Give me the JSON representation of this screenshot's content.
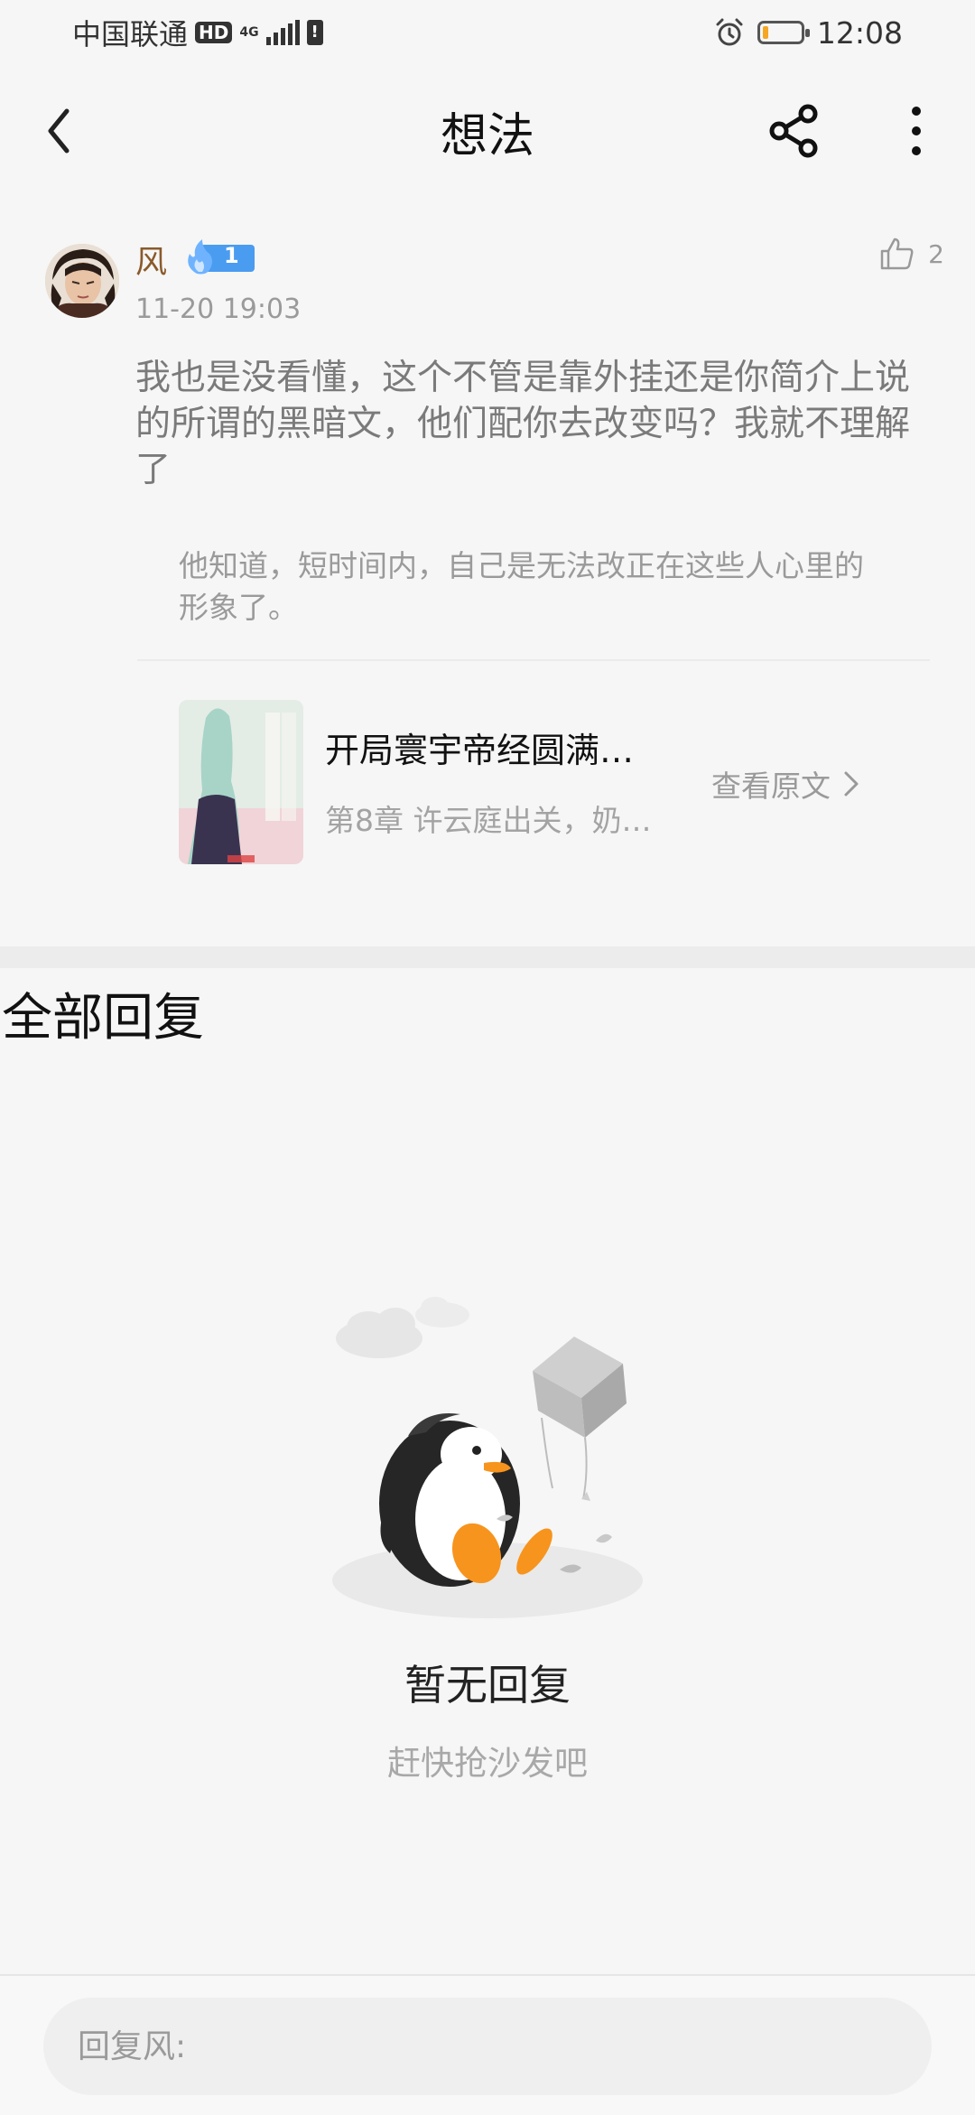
{
  "status_bar": {
    "carrier": "中国联通",
    "hd_badge": "HD",
    "network": "4G",
    "sim_alert": "!",
    "time": "12:08",
    "battery_level_percent": 15,
    "battery_color": "#f5a623"
  },
  "header": {
    "title": "想法",
    "back_icon": "chevron-left-icon",
    "share_icon": "share-icon",
    "more_icon": "more-vertical-icon"
  },
  "post": {
    "author": "风",
    "level": "1",
    "time": "11-20 19:03",
    "like_count": "2",
    "text": "我也是没看懂，这个不管是靠外挂还是你简介上说的所谓的黑暗文，他们配你去改变吗？我就不理解了",
    "quote": "他知道，短时间内，自己是无法改正在这些人心里的形象了。"
  },
  "book": {
    "title": "开局寰宇帝经圆满…",
    "chapter": "第8章 许云庭出关，奶…",
    "view_original": "查看原文"
  },
  "replies": {
    "section_title": "全部回复",
    "empty_title": "暂无回复",
    "empty_subtitle": "赶快抢沙发吧"
  },
  "reply_bar": {
    "placeholder": "回复风:"
  }
}
